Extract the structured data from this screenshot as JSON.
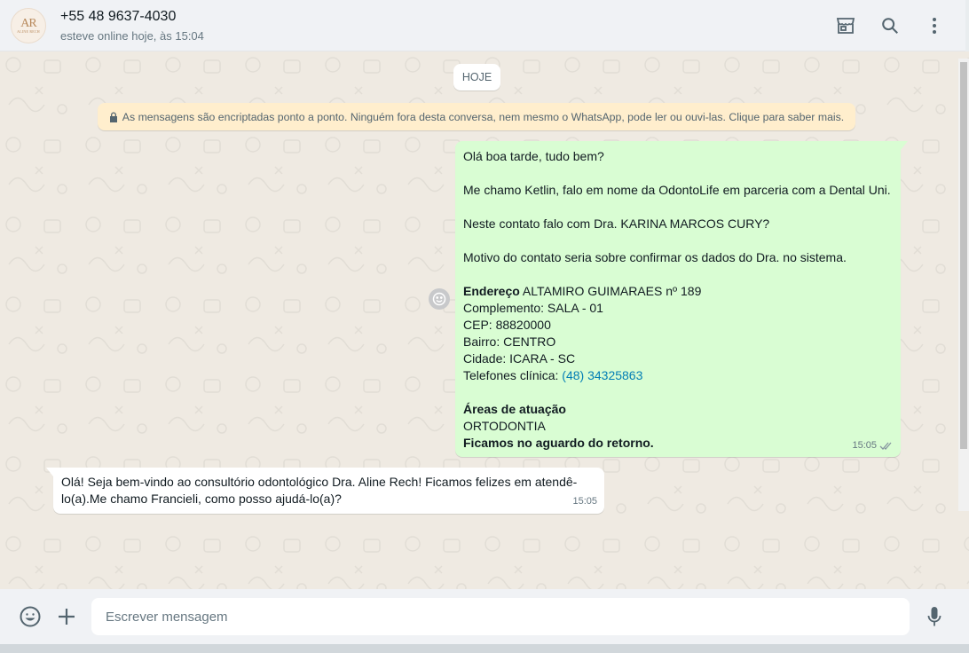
{
  "header": {
    "avatar_mono": "AR",
    "avatar_sub": "ALINE RECH",
    "contact_name": "+55 48 9637-4030",
    "contact_status": "esteve online hoje, às 15:04",
    "icons": [
      "store-icon",
      "search-icon",
      "menu-dots-icon"
    ]
  },
  "chat": {
    "date_label": "HOJE",
    "encryption_notice": "As mensagens são encriptadas ponto a ponto. Ninguém fora desta conversa, nem mesmo o WhatsApp, pode ler ou ouvi-las. Clique para saber mais.",
    "outgoing": {
      "greeting": "Olá boa tarde, tudo bem?",
      "intro": "Me chamo Ketlin, falo em nome da OdontoLife em parceria com a Dental Uni.",
      "question": "Neste contato falo com Dra. KARINA MARCOS CURY?",
      "reason": "Motivo do contato seria sobre confirmar os dados do Dra. no sistema.",
      "address_label": "Endereço",
      "address_value": " ALTAMIRO GUIMARAES nº 189",
      "complement": "Complemento: SALA - 01",
      "cep": "CEP: 88820000",
      "bairro": "Bairro: CENTRO",
      "cidade": "Cidade: ICARA - SC",
      "phone_label": "Telefones clínica: ",
      "phone_link": "(48) 34325863",
      "areas_label": "Áreas de atuação",
      "areas_value": "ORTODONTIA",
      "closing": "Ficamos no aguardo do retorno.",
      "time": "15:05",
      "status": "read"
    },
    "incoming": {
      "line1": "Olá! Seja bem-vindo ao consultório odontológico Dra. Aline Rech! Ficamos felizes em atendê-",
      "line2": "lo(a).Me chamo Francieli, como posso ajudá-lo(a)?",
      "time": "15:05"
    }
  },
  "footer": {
    "compose_placeholder": "Escrever mensagem",
    "compose_value": ""
  },
  "colors": {
    "outgoing_bubble": "#d9fdd3",
    "incoming_bubble": "#ffffff",
    "notice_bg": "#ffeecd",
    "link": "#027eb5",
    "chat_bg": "#efeae2"
  }
}
